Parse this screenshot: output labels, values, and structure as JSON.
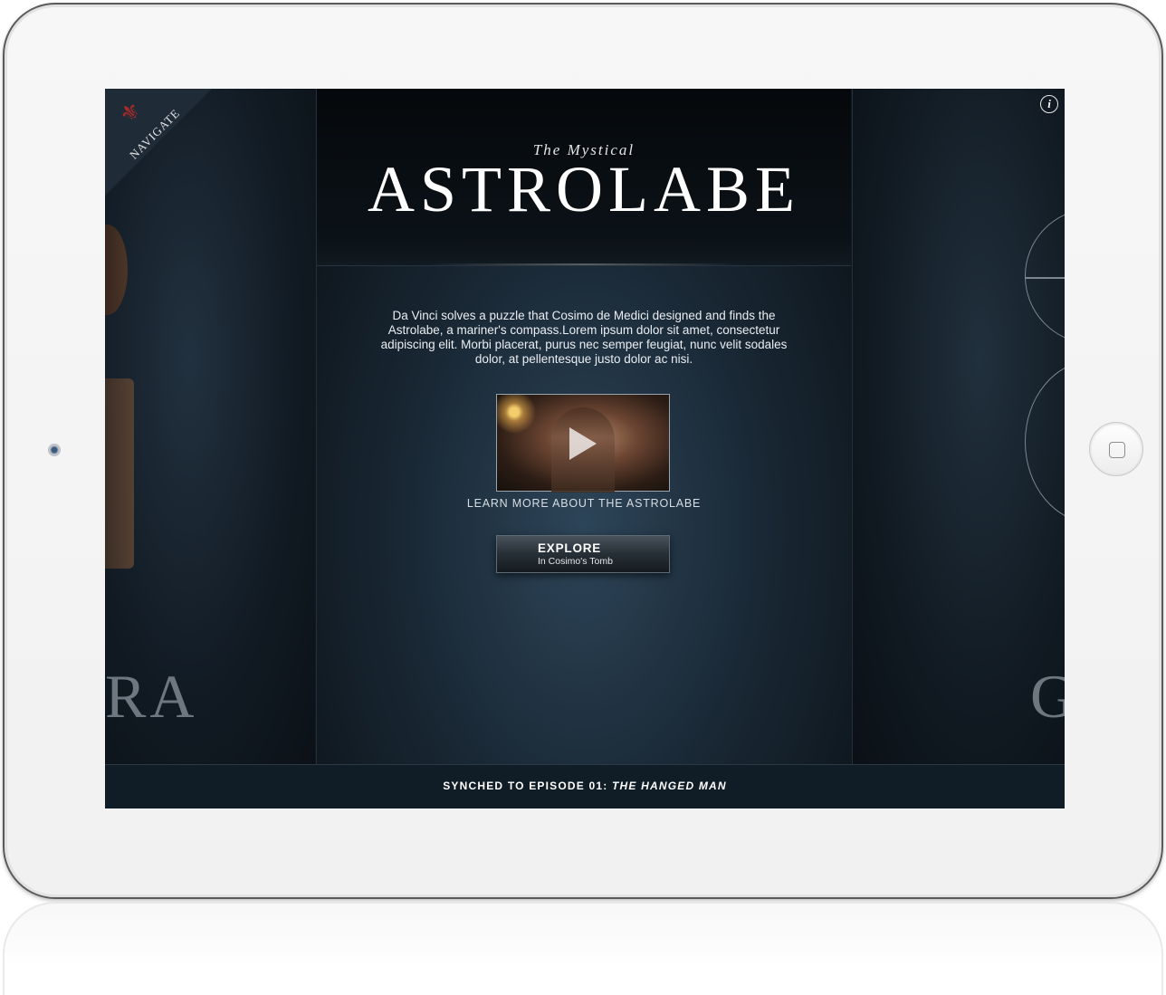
{
  "screen": {
    "navigate_label": "NAVIGATE",
    "info_label": "i",
    "title": {
      "subtitle": "The Mystical",
      "main": "ASTROLABE"
    },
    "description": "Da Vinci solves a puzzle that Cosimo de Medici designed and finds the Astrolabe, a mariner's compass.Lorem ipsum dolor sit amet, consectetur adipiscing elit. Morbi placerat, purus nec semper feugiat, nunc velit sodales dolor, at pellentesque justo dolor ac nisi.",
    "video": {
      "caption": "LEARN MORE ABOUT THE ASTROLABE"
    },
    "explore_button": {
      "label": "EXPLORE",
      "sublabel": "In Cosimo's Tomb"
    },
    "left_panel_word": "RA",
    "right_panel_word": "G",
    "footer": {
      "prefix": "SYNCHED TO EPISODE 01: ",
      "episode": "THE HANGED MAN"
    }
  },
  "colors": {
    "accent_red": "#a82a2a",
    "background_dark": "#0f1820",
    "footer_bg": "#101c26"
  }
}
